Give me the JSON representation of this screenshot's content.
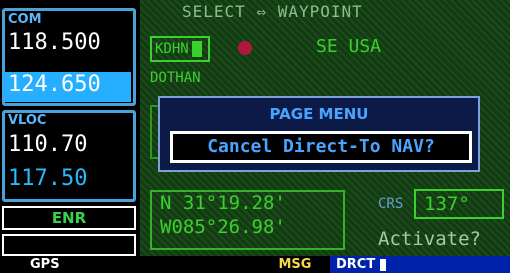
{
  "screen": {
    "title": "SELECT ⇔ WAYPOINT",
    "ident": "KDHN",
    "region": "SE USA",
    "facility": "DOTHAN"
  },
  "com": {
    "label": "COM",
    "active": "118.500",
    "standby": "124.650"
  },
  "vloc": {
    "label": "VLOC",
    "active": "110.70",
    "standby": "117.50"
  },
  "cdi_mode": "ENR",
  "position": {
    "lat": "N 31°19.28'",
    "lon": "W085°26.98'"
  },
  "course": {
    "label": "CRS",
    "value": "137°"
  },
  "activate_prompt": "Activate?",
  "page_menu": {
    "title": "PAGE MENU",
    "item": "Cancel Direct-To NAV?"
  },
  "status_bar": {
    "mode": "GPS",
    "msg": "MSG",
    "drct": "DRCT"
  },
  "colors": {
    "accent_blue": "#4aa3d8",
    "nav_green": "#3bd12d",
    "msg_yellow": "#f7d84a"
  }
}
